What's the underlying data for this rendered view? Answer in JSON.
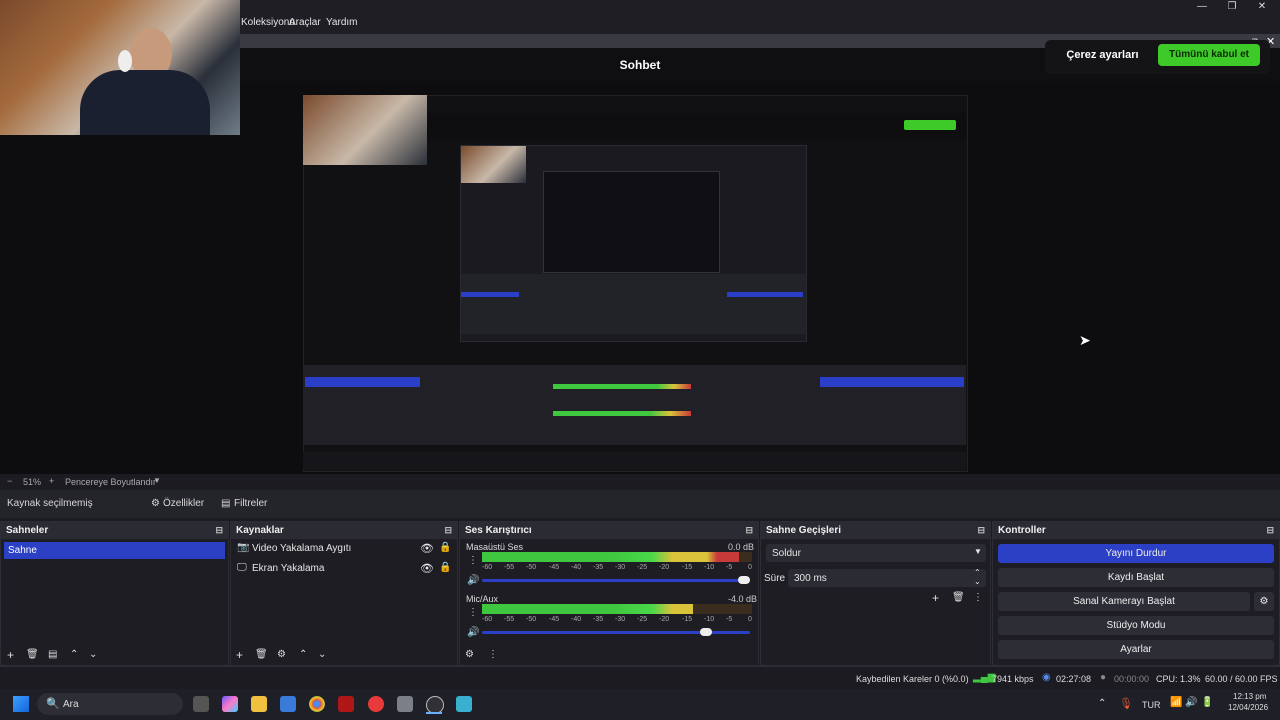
{
  "menu": {
    "items": [
      "Koleksiyonu",
      "Araçlar",
      "Yardım"
    ]
  },
  "browser": {
    "title": "Sohbet",
    "cookie_settings": "Çerez ayarları",
    "accept_all": "Tümünü kabul et"
  },
  "zoom": {
    "minus": "−",
    "value": "51%",
    "plus": "+",
    "mode": "Pencereye Boyutlandır"
  },
  "source_toolbar": {
    "no_source": "Kaynak seçilmemiş",
    "properties": "Özellikler",
    "filters": "Filtreler"
  },
  "scenes": {
    "title": "Sahneler",
    "items": [
      "Sahne"
    ]
  },
  "sources": {
    "title": "Kaynaklar",
    "items": [
      "Video Yakalama Aygıtı",
      "Ekran Yakalama"
    ]
  },
  "mixer": {
    "title": "Ses Karıştırıcı",
    "channels": [
      {
        "name": "Masaüstü Ses",
        "db": "0.0 dB",
        "level": 0.95,
        "volume": 1.0
      },
      {
        "name": "Mic/Aux",
        "db": "-4.0 dB",
        "level": 0.78,
        "volume": 0.85
      }
    ],
    "ticks": [
      "-60",
      "-55",
      "-50",
      "-45",
      "-40",
      "-35",
      "-30",
      "-25",
      "-20",
      "-15",
      "-10",
      "-5",
      "0"
    ]
  },
  "transitions": {
    "title": "Sahne Geçişleri",
    "selected": "Soldur",
    "duration_label": "Süre",
    "duration_value": "300 ms"
  },
  "controls": {
    "title": "Kontroller",
    "stop_stream": "Yayını Durdur",
    "start_record": "Kaydı Başlat",
    "start_vcam": "Sanal Kamerayı Başlat",
    "studio_mode": "Stüdyo Modu",
    "settings": "Ayarlar"
  },
  "status": {
    "dropped": "Kaybedilen Kareler 0 (%0.0)",
    "bitrate": "7941 kbps",
    "stream_time": "02:27:08",
    "rec_time": "00:00:00",
    "cpu": "CPU: 1.3%",
    "fps": "60.00 / 60.00 FPS"
  },
  "taskbar": {
    "search": "Ara",
    "lang": "TUR",
    "time": "12:13 pm",
    "date": "12/04/2026"
  },
  "colors": {
    "accent": "#2c40c6",
    "green": "#3ecb2a",
    "meter_green": "#3fc73f",
    "meter_yellow": "#d8c33a",
    "meter_red": "#c83a3a"
  }
}
